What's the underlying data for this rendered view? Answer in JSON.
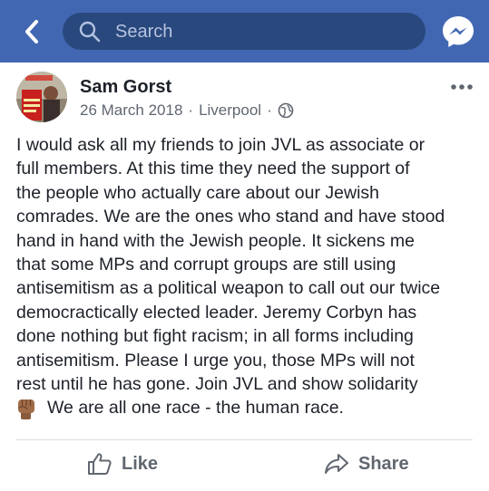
{
  "header": {
    "back_icon": "chevron-left-icon",
    "search_placeholder": "Search",
    "search_icon": "search-icon",
    "messenger_icon": "messenger-icon",
    "bar_color": "#4267b2"
  },
  "post": {
    "author": "Sam Gorst",
    "date": "26 March 2018",
    "separator": "·",
    "location": "Liverpool",
    "privacy_icon": "globe-icon",
    "more_icon": "more-horizontal-icon",
    "lines": [
      "I would ask all my friends to join JVL as associate or",
      "full members. At this time they need the support of",
      "the people who actually care about our Jewish",
      "comrades. We are the ones who stand and have stood",
      "hand in hand with the Jewish people. It sickens me",
      "that some MPs and corrupt groups are still using",
      "antisemitism as a political weapon to call out our twice",
      "democractically elected leader. Jeremy Corbyn has",
      "done nothing but fight racism; in all forms including",
      "antisemitism. Please I urge you, those MPs will not",
      "rest until he has gone. Join JVL and show solidarity"
    ],
    "final_line": "We are all one race - the human race.",
    "final_emoji": "raised-fist-icon"
  },
  "actions": {
    "like_label": "Like",
    "share_label": "Share"
  }
}
